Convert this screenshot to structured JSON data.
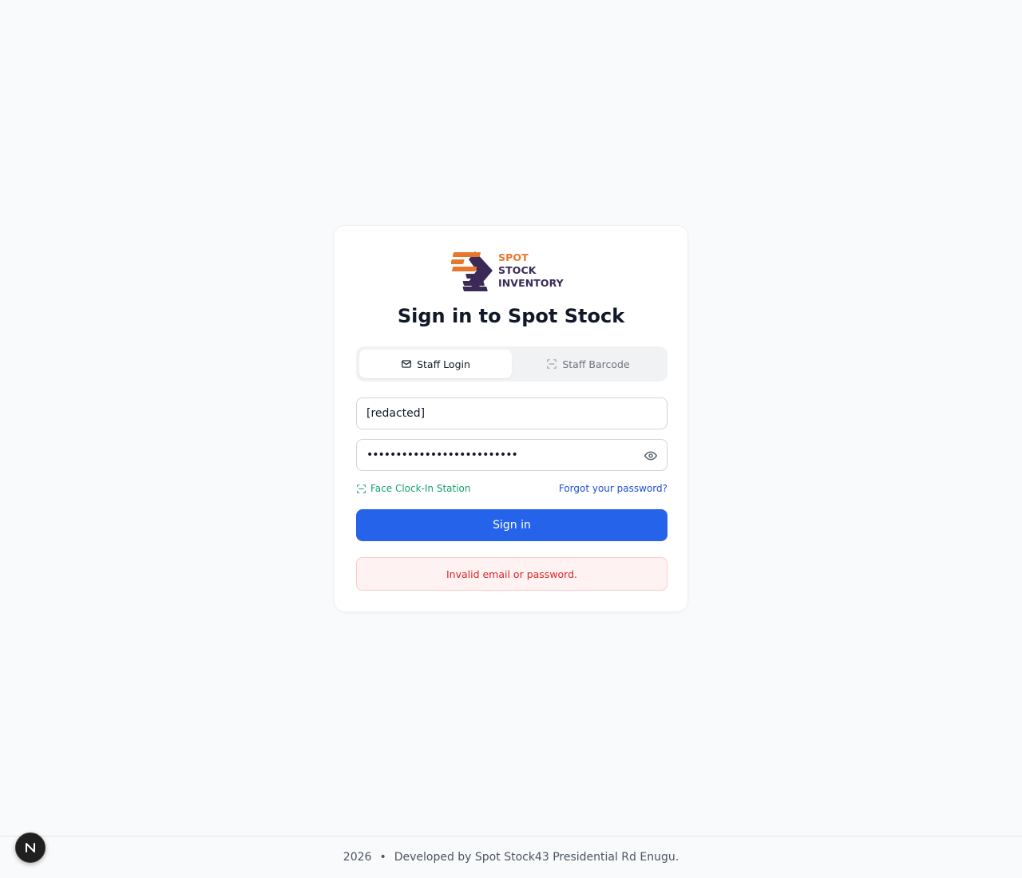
{
  "brand": {
    "line1": "SPOT",
    "line2": "STOCK",
    "line3": "INVENTORY",
    "accent_color": "#e8772e",
    "dark_color": "#3b2a57"
  },
  "page_title": "Sign in to Spot Stock",
  "tabs": [
    {
      "label": "Staff Login",
      "icon": "mail-icon",
      "active": true
    },
    {
      "label": "Staff Barcode",
      "icon": "scan-icon",
      "active": false
    }
  ],
  "form": {
    "email_value": "[redacted]",
    "password_value": "••••••••••••••••••••••••••",
    "face_clockin_label": "Face Clock-In Station",
    "forgot_label": "Forgot your password?",
    "signin_label": "Sign in",
    "error_message": "Invalid email or password."
  },
  "footer": {
    "year": "2026",
    "separator": "•",
    "text": "Developed by Spot Stock43 Presidential Rd Enugu."
  },
  "colors": {
    "primary": "#2563eb",
    "success": "#16a06a",
    "error": "#dc2626"
  },
  "dev_badge": {
    "letter": "N"
  }
}
